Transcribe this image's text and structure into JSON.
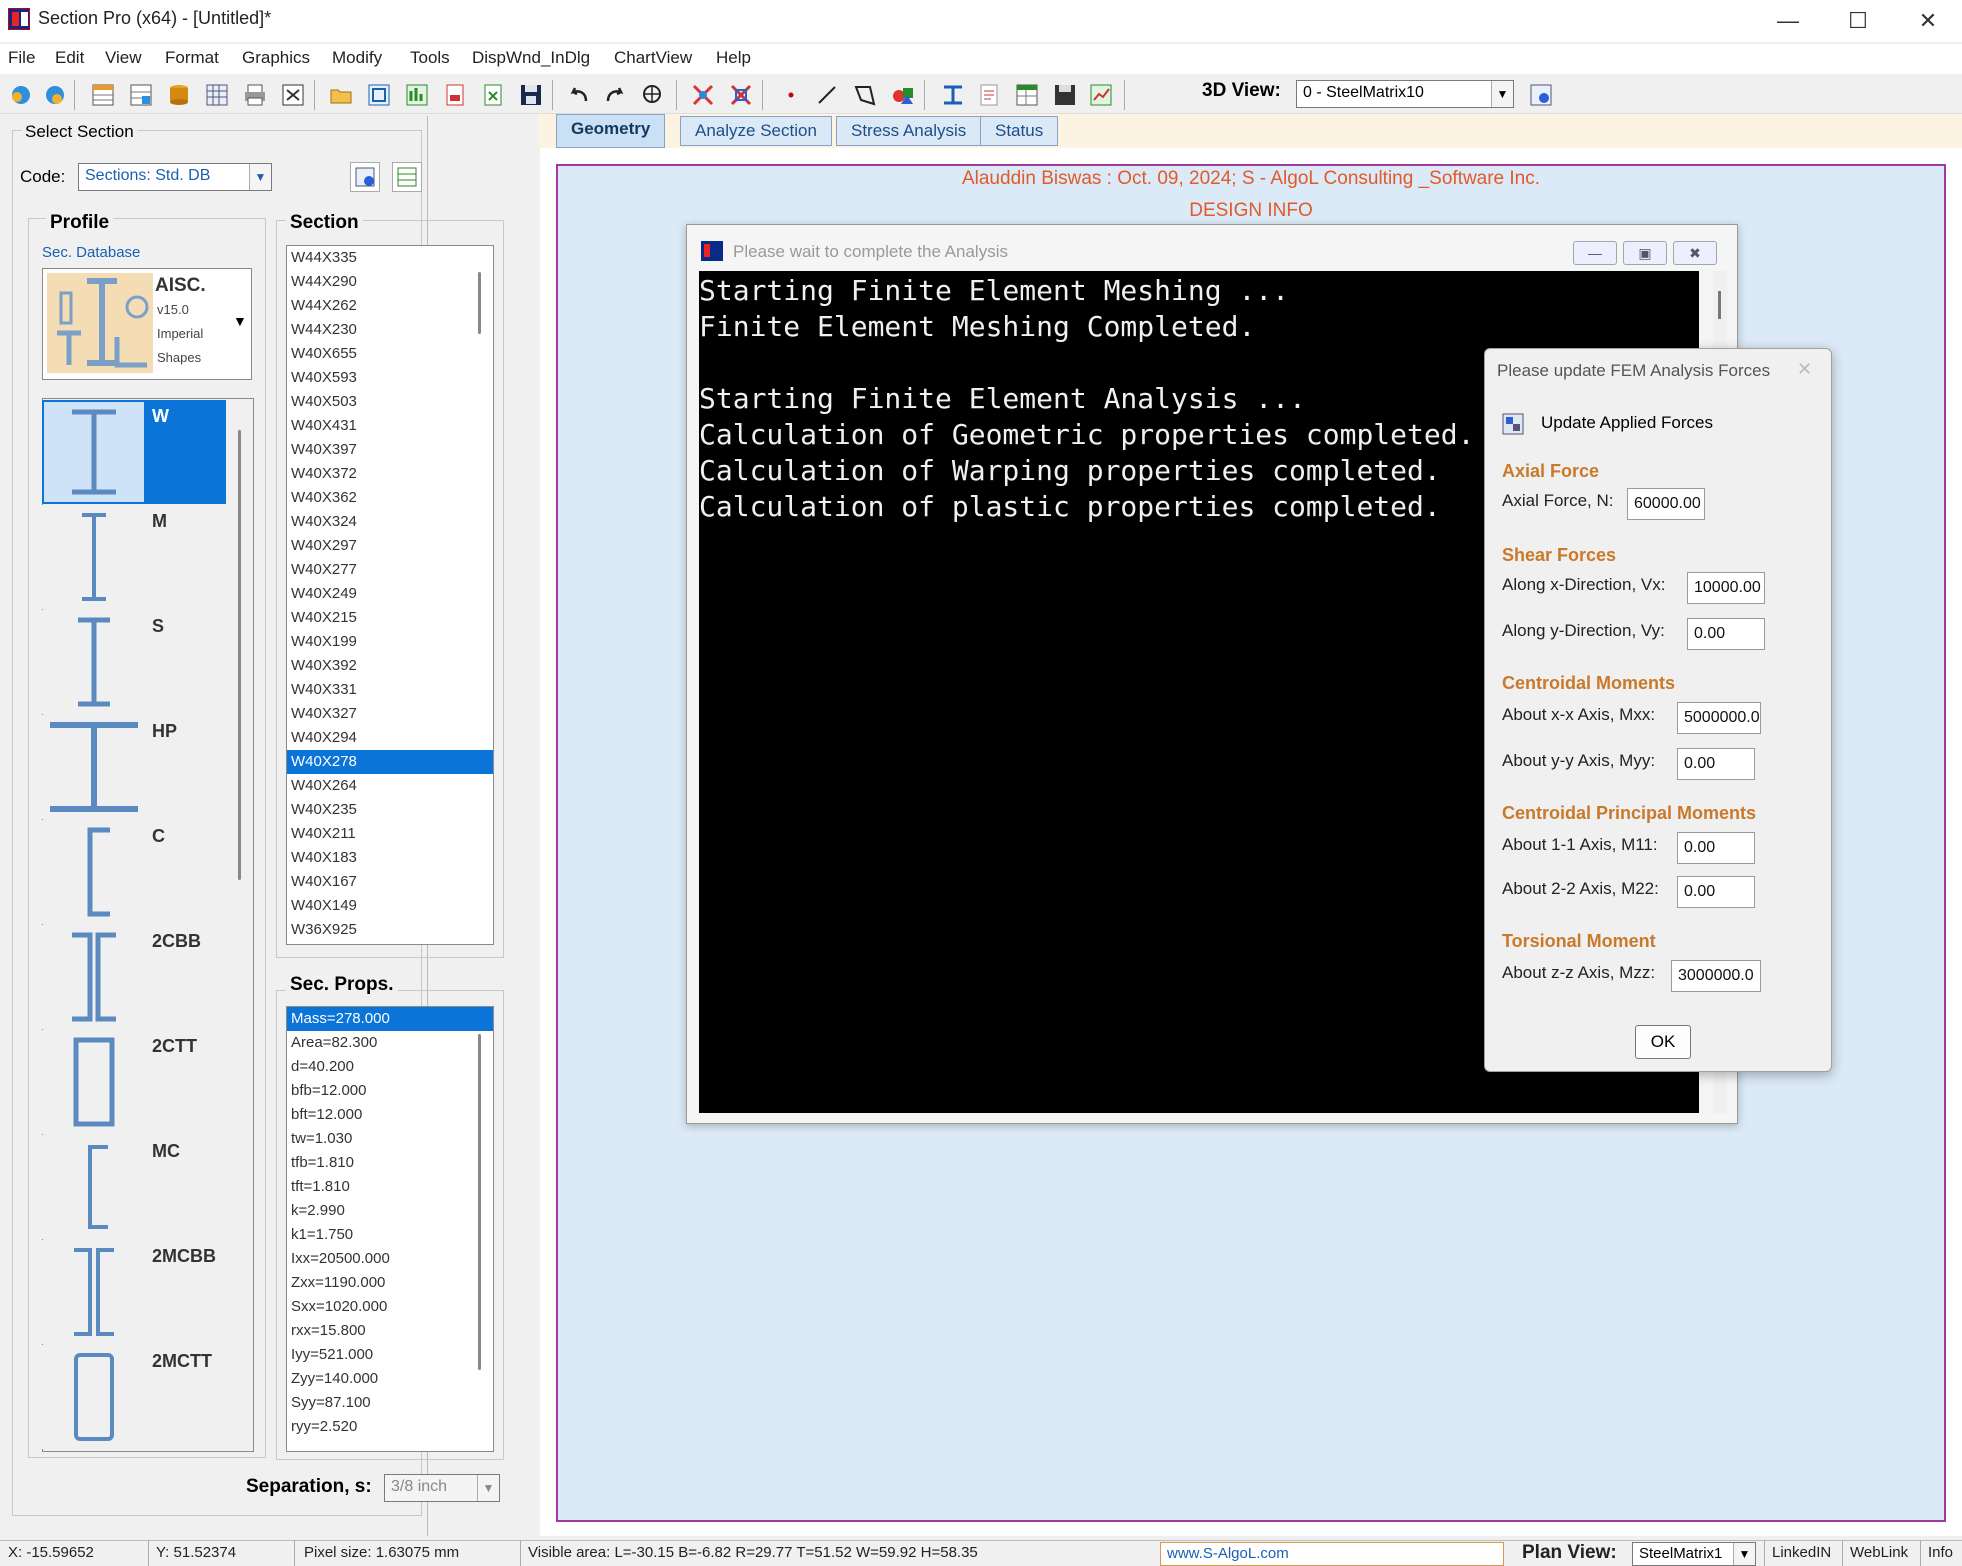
{
  "app": {
    "title": "Section Pro (x64) - [Untitled]*"
  },
  "menu": [
    "File",
    "Edit",
    "View",
    "Format",
    "Graphics",
    "Modify",
    "Tools",
    "DispWnd_InDlg",
    "ChartView",
    "Help"
  ],
  "toolbar": {
    "view3d_label": "3D View:",
    "view3d_value": "0 - SteelMatrix10"
  },
  "left": {
    "select_section_title": "Select Section",
    "code_label": "Code:",
    "code_value": "Sections: Std. DB",
    "profile_title": "Profile",
    "sec_database_label": "Sec. Database",
    "database_card": {
      "title": "AISC.",
      "version": "v15.0",
      "line1": "Imperial",
      "line2": "Shapes"
    },
    "profiles": [
      "W",
      "M",
      "S",
      "HP",
      "C",
      "2CBB",
      "2CTT",
      "MC",
      "2MCBB",
      "2MCTT"
    ],
    "section_title": "Section",
    "sections": [
      "W44X335",
      "W44X290",
      "W44X262",
      "W44X230",
      "W40X655",
      "W40X593",
      "W40X503",
      "W40X431",
      "W40X397",
      "W40X372",
      "W40X362",
      "W40X324",
      "W40X297",
      "W40X277",
      "W40X249",
      "W40X215",
      "W40X199",
      "W40X392",
      "W40X331",
      "W40X327",
      "W40X294",
      "W40X278",
      "W40X264",
      "W40X235",
      "W40X211",
      "W40X183",
      "W40X167",
      "W40X149",
      "W36X925"
    ],
    "selected_section": "W40X278",
    "sec_props_title": "Sec. Props.",
    "sec_props": [
      "Mass=278.000",
      "Area=82.300",
      "d=40.200",
      "bfb=12.000",
      "bft=12.000",
      "tw=1.030",
      "tfb=1.810",
      "tft=1.810",
      "k=2.990",
      "k1=1.750",
      "Ixx=20500.000",
      "Zxx=1190.000",
      "Sxx=1020.000",
      "rxx=15.800",
      "Iyy=521.000",
      "Zyy=140.000",
      "Syy=87.100",
      "ryy=2.520"
    ],
    "separation_label": "Separation, s:",
    "separation_value": "3/8 inch"
  },
  "tabs": [
    "Geometry",
    "Analyze Section",
    "Stress Analysis",
    "Status"
  ],
  "active_tab": "Geometry",
  "drawing": {
    "header": "Alauddin Biswas : Oct. 09, 2024; S - AlgoL Consulting _Software Inc.",
    "design_info": "DESIGN INFO"
  },
  "analysis_window": {
    "title": "Please wait to complete the Analysis",
    "lines": [
      "Starting Finite Element Meshing ...",
      "Finite Element Meshing Completed.",
      "",
      "Starting Finite Element Analysis ...",
      "Calculation of Geometric properties completed.",
      "Calculation of Warping properties completed.",
      "Calculation of plastic properties completed."
    ]
  },
  "force_dialog": {
    "title": "Please update FEM Analysis Forces",
    "update_label": "Update Applied Forces",
    "axial_section": "Axial Force",
    "axial_label": "Axial Force, N:",
    "axial_value": "60000.00",
    "shear_section": "Shear Forces",
    "vx_label": "Along x-Direction, Vx:",
    "vx_value": "10000.00",
    "vy_label": "Along y-Direction, Vy:",
    "vy_value": "0.00",
    "centroidal_section": "Centroidal Moments",
    "mxx_label": "About x-x Axis, Mxx:",
    "mxx_value": "5000000.0",
    "myy_label": "About y-y Axis, Myy:",
    "myy_value": "0.00",
    "principal_section": "Centroidal Principal Moments",
    "m11_label": "About 1-1 Axis, M11:",
    "m11_value": "0.00",
    "m22_label": "About 2-2 Axis, M22:",
    "m22_value": "0.00",
    "torsional_section": "Torsional Moment",
    "mzz_label": "About z-z Axis, Mzz:",
    "mzz_value": "3000000.0",
    "ok_label": "OK"
  },
  "status": {
    "x": "X: -15.59652",
    "y": "Y: 51.52374",
    "pixel_size": "Pixel size: 1.63075 mm",
    "visible_area": "Visible area:  L=-30.15  B=-6.82  R=29.77  T=51.52   W=59.92  H=58.35",
    "website": "www.S-AlgoL.com",
    "plan_view_label": "Plan View:",
    "plan_view_value": "SteelMatrix1",
    "linkedin": "LinkedIN",
    "weblink": "WebLink",
    "info": "Info"
  },
  "colors": {
    "accent": "#0a74d8",
    "section_heading": "#c87a2a",
    "drawing_bg": "#dbeaf6",
    "frame": "#a03aa0",
    "header_text": "#e05a2a"
  }
}
